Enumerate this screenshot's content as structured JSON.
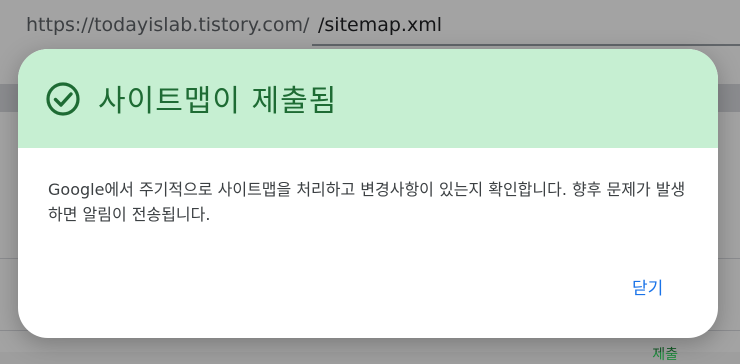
{
  "background": {
    "url_prefix": "https://todayislab.tistory.com/",
    "url_value": "/sitemap.xml",
    "partial_text": "제출"
  },
  "dialog": {
    "title": "사이트맵이 제출됨",
    "icon": "check-circle-icon",
    "header_color": "#c6efd2",
    "accent_color": "#1e6b34",
    "message": "Google에서 주기적으로 사이트맵을 처리하고 변경사항이 있는지 확인합니다. 향후 문제가 발생하면 알림이 전송됩니다.",
    "close_label": "닫기",
    "close_color": "#1a73e8"
  }
}
